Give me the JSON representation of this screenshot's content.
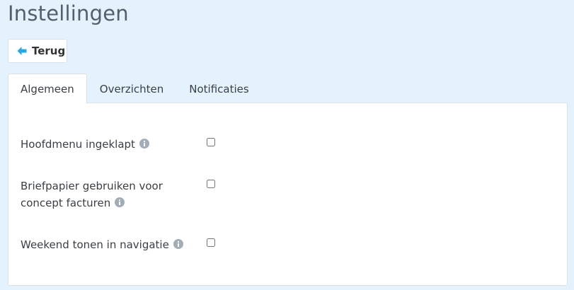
{
  "page": {
    "title": "Instellingen"
  },
  "back_button": {
    "label": "Terug",
    "icon": "arrow-left-icon",
    "icon_color": "#29a8e0"
  },
  "tabs": [
    {
      "label": "Algemeen",
      "active": true
    },
    {
      "label": "Overzichten",
      "active": false
    },
    {
      "label": "Notificaties",
      "active": false
    }
  ],
  "settings": [
    {
      "label": "Hoofdmenu ingeklapt",
      "icon": "info-icon",
      "checked": false
    },
    {
      "label_line1": "Briefpapier gebruiken voor",
      "label_line2": "concept facturen",
      "icon": "info-icon",
      "checked": false
    },
    {
      "label": "Weekend tonen in navigatie",
      "icon": "info-icon",
      "checked": false
    }
  ],
  "colors": {
    "background": "#e3f2fc",
    "panel": "#ffffff",
    "info_icon": "#a3adb8",
    "accent": "#29a8e0"
  }
}
